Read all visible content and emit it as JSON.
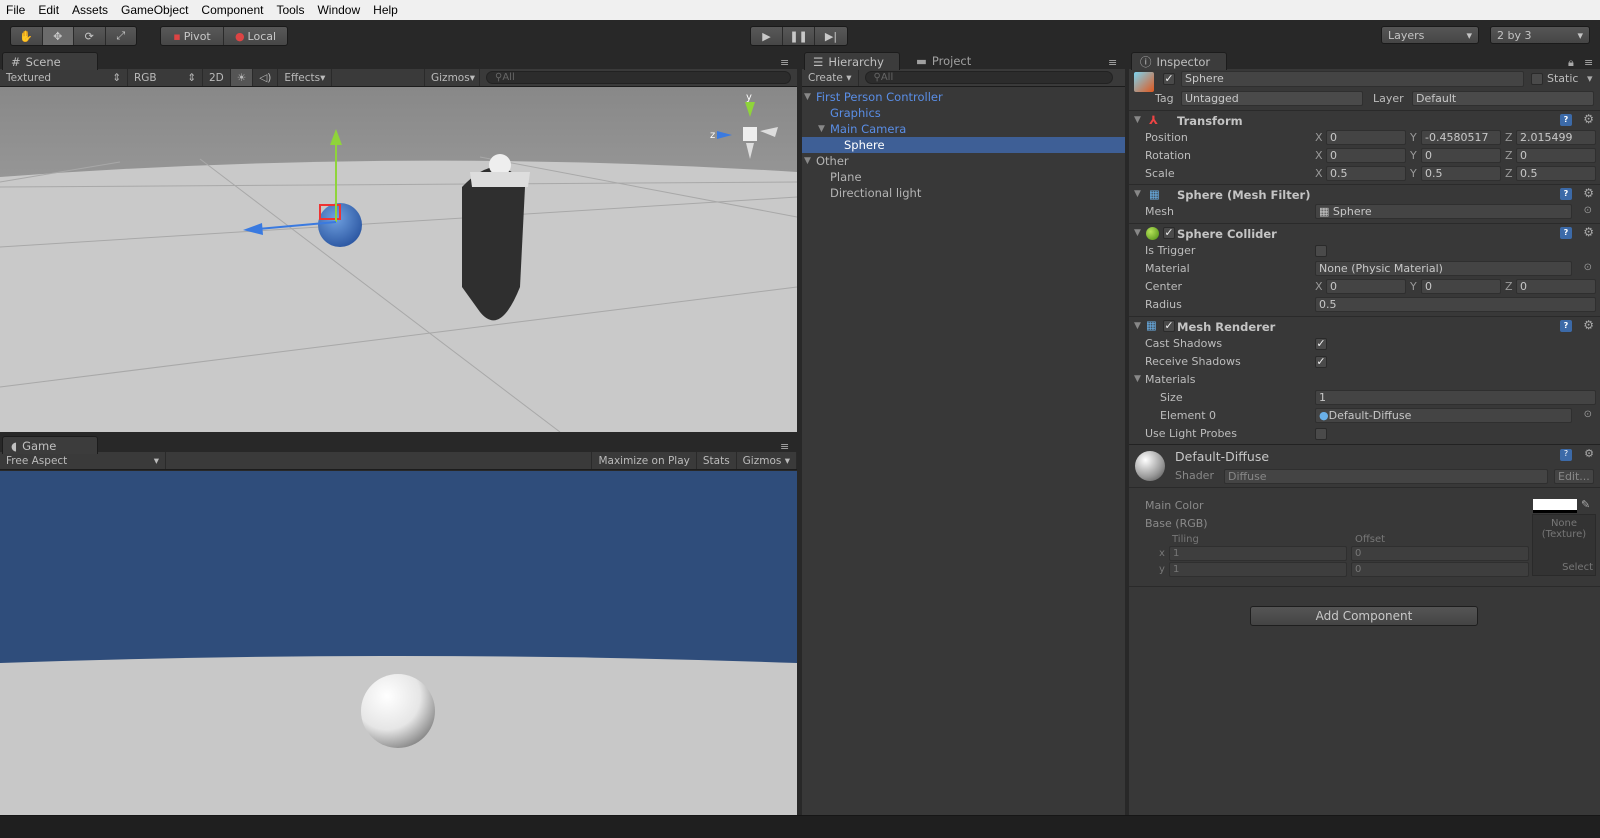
{
  "menu": [
    "File",
    "Edit",
    "Assets",
    "GameObject",
    "Component",
    "Tools",
    "Window",
    "Help"
  ],
  "toolbar": {
    "tools": [
      "hand-icon",
      "move-icon",
      "rotate-icon",
      "scale-icon"
    ],
    "pivot": "Pivot",
    "local": "Local",
    "layers": "Layers",
    "layout": "2 by 3"
  },
  "scene": {
    "tab": "Scene",
    "draw_mode": "Textured",
    "render_mode": "RGB",
    "mode_2d": "2D",
    "effects": "Effects",
    "gizmos": "Gizmos",
    "search_placeholder": "All",
    "axis_y": "y",
    "axis_z": "z"
  },
  "game": {
    "tab": "Game",
    "aspect": "Free Aspect",
    "maximize": "Maximize on Play",
    "stats": "Stats",
    "gizmos": "Gizmos",
    "sky_color": "#2f4d7b",
    "ground_color": "#c8c8c8"
  },
  "hierarchy": {
    "tab": "Hierarchy",
    "project_tab": "Project",
    "create": "Create",
    "search_placeholder": "All",
    "items": [
      {
        "label": "First Person Controller",
        "depth": 0,
        "expanded": true,
        "prefab": true
      },
      {
        "label": "Graphics",
        "depth": 1,
        "prefab": true
      },
      {
        "label": "Main Camera",
        "depth": 1,
        "expanded": true,
        "prefab": true
      },
      {
        "label": "Sphere",
        "depth": 2,
        "selected": true
      },
      {
        "label": "Other",
        "depth": 0,
        "expanded": true
      },
      {
        "label": "Plane",
        "depth": 1
      },
      {
        "label": "Directional light",
        "depth": 1
      }
    ]
  },
  "inspector": {
    "tab": "Inspector",
    "name": "Sphere",
    "static": "Static",
    "tag_label": "Tag",
    "tag": "Untagged",
    "layer_label": "Layer",
    "layer": "Default",
    "transform": {
      "title": "Transform",
      "position_label": "Position",
      "rotation_label": "Rotation",
      "scale_label": "Scale",
      "position": [
        "0",
        "-0.4580517",
        "2.015499"
      ],
      "rotation": [
        "0",
        "0",
        "0"
      ],
      "scale": [
        "0.5",
        "0.5",
        "0.5"
      ]
    },
    "mesh_filter": {
      "title": "Sphere (Mesh Filter)",
      "mesh_label": "Mesh",
      "mesh": "Sphere"
    },
    "collider": {
      "title": "Sphere Collider",
      "is_trigger_label": "Is Trigger",
      "is_trigger": false,
      "material_label": "Material",
      "material": "None (Physic Material)",
      "center_label": "Center",
      "center": [
        "0",
        "0",
        "0"
      ],
      "radius_label": "Radius",
      "radius": "0.5"
    },
    "renderer": {
      "title": "Mesh Renderer",
      "cast_label": "Cast Shadows",
      "cast": true,
      "receive_label": "Receive Shadows",
      "receive": true,
      "materials_label": "Materials",
      "size_label": "Size",
      "size": "1",
      "element0_label": "Element 0",
      "element0": "Default-Diffuse",
      "probes_label": "Use Light Probes",
      "probes": false
    },
    "material": {
      "name": "Default-Diffuse",
      "shader_label": "Shader",
      "shader": "Diffuse",
      "edit": "Edit...",
      "main_color_label": "Main Color",
      "main_color": "#ffffff",
      "base_label": "Base (RGB)",
      "tiling_label": "Tiling",
      "offset_label": "Offset",
      "x_label": "x",
      "y_label": "y",
      "tiling": [
        "1",
        "1"
      ],
      "offset": [
        "0",
        "0"
      ],
      "texture": "None\n(Texture)",
      "select": "Select"
    },
    "add_component": "Add Component",
    "axes": [
      "X",
      "Y",
      "Z"
    ],
    "check": "✓"
  }
}
